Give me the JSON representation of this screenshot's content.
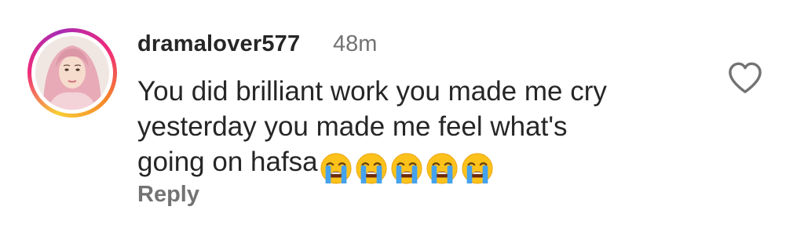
{
  "comment": {
    "username": "dramalover577",
    "timestamp": "48m",
    "text_line1": "You did brilliant work you made me cry",
    "text_line2": "yesterday you made me feel what's",
    "text_line3": "going on hafsa",
    "emojis": [
      "loudly-crying-face",
      "loudly-crying-face",
      "loudly-crying-face",
      "loudly-crying-face",
      "loudly-crying-face"
    ],
    "reply_label": "Reply",
    "like_icon": "heart-outline-icon",
    "avatar_ring_colors": [
      "#f9ce34",
      "#ee2a7b",
      "#a72bb5",
      "#f58529"
    ]
  }
}
